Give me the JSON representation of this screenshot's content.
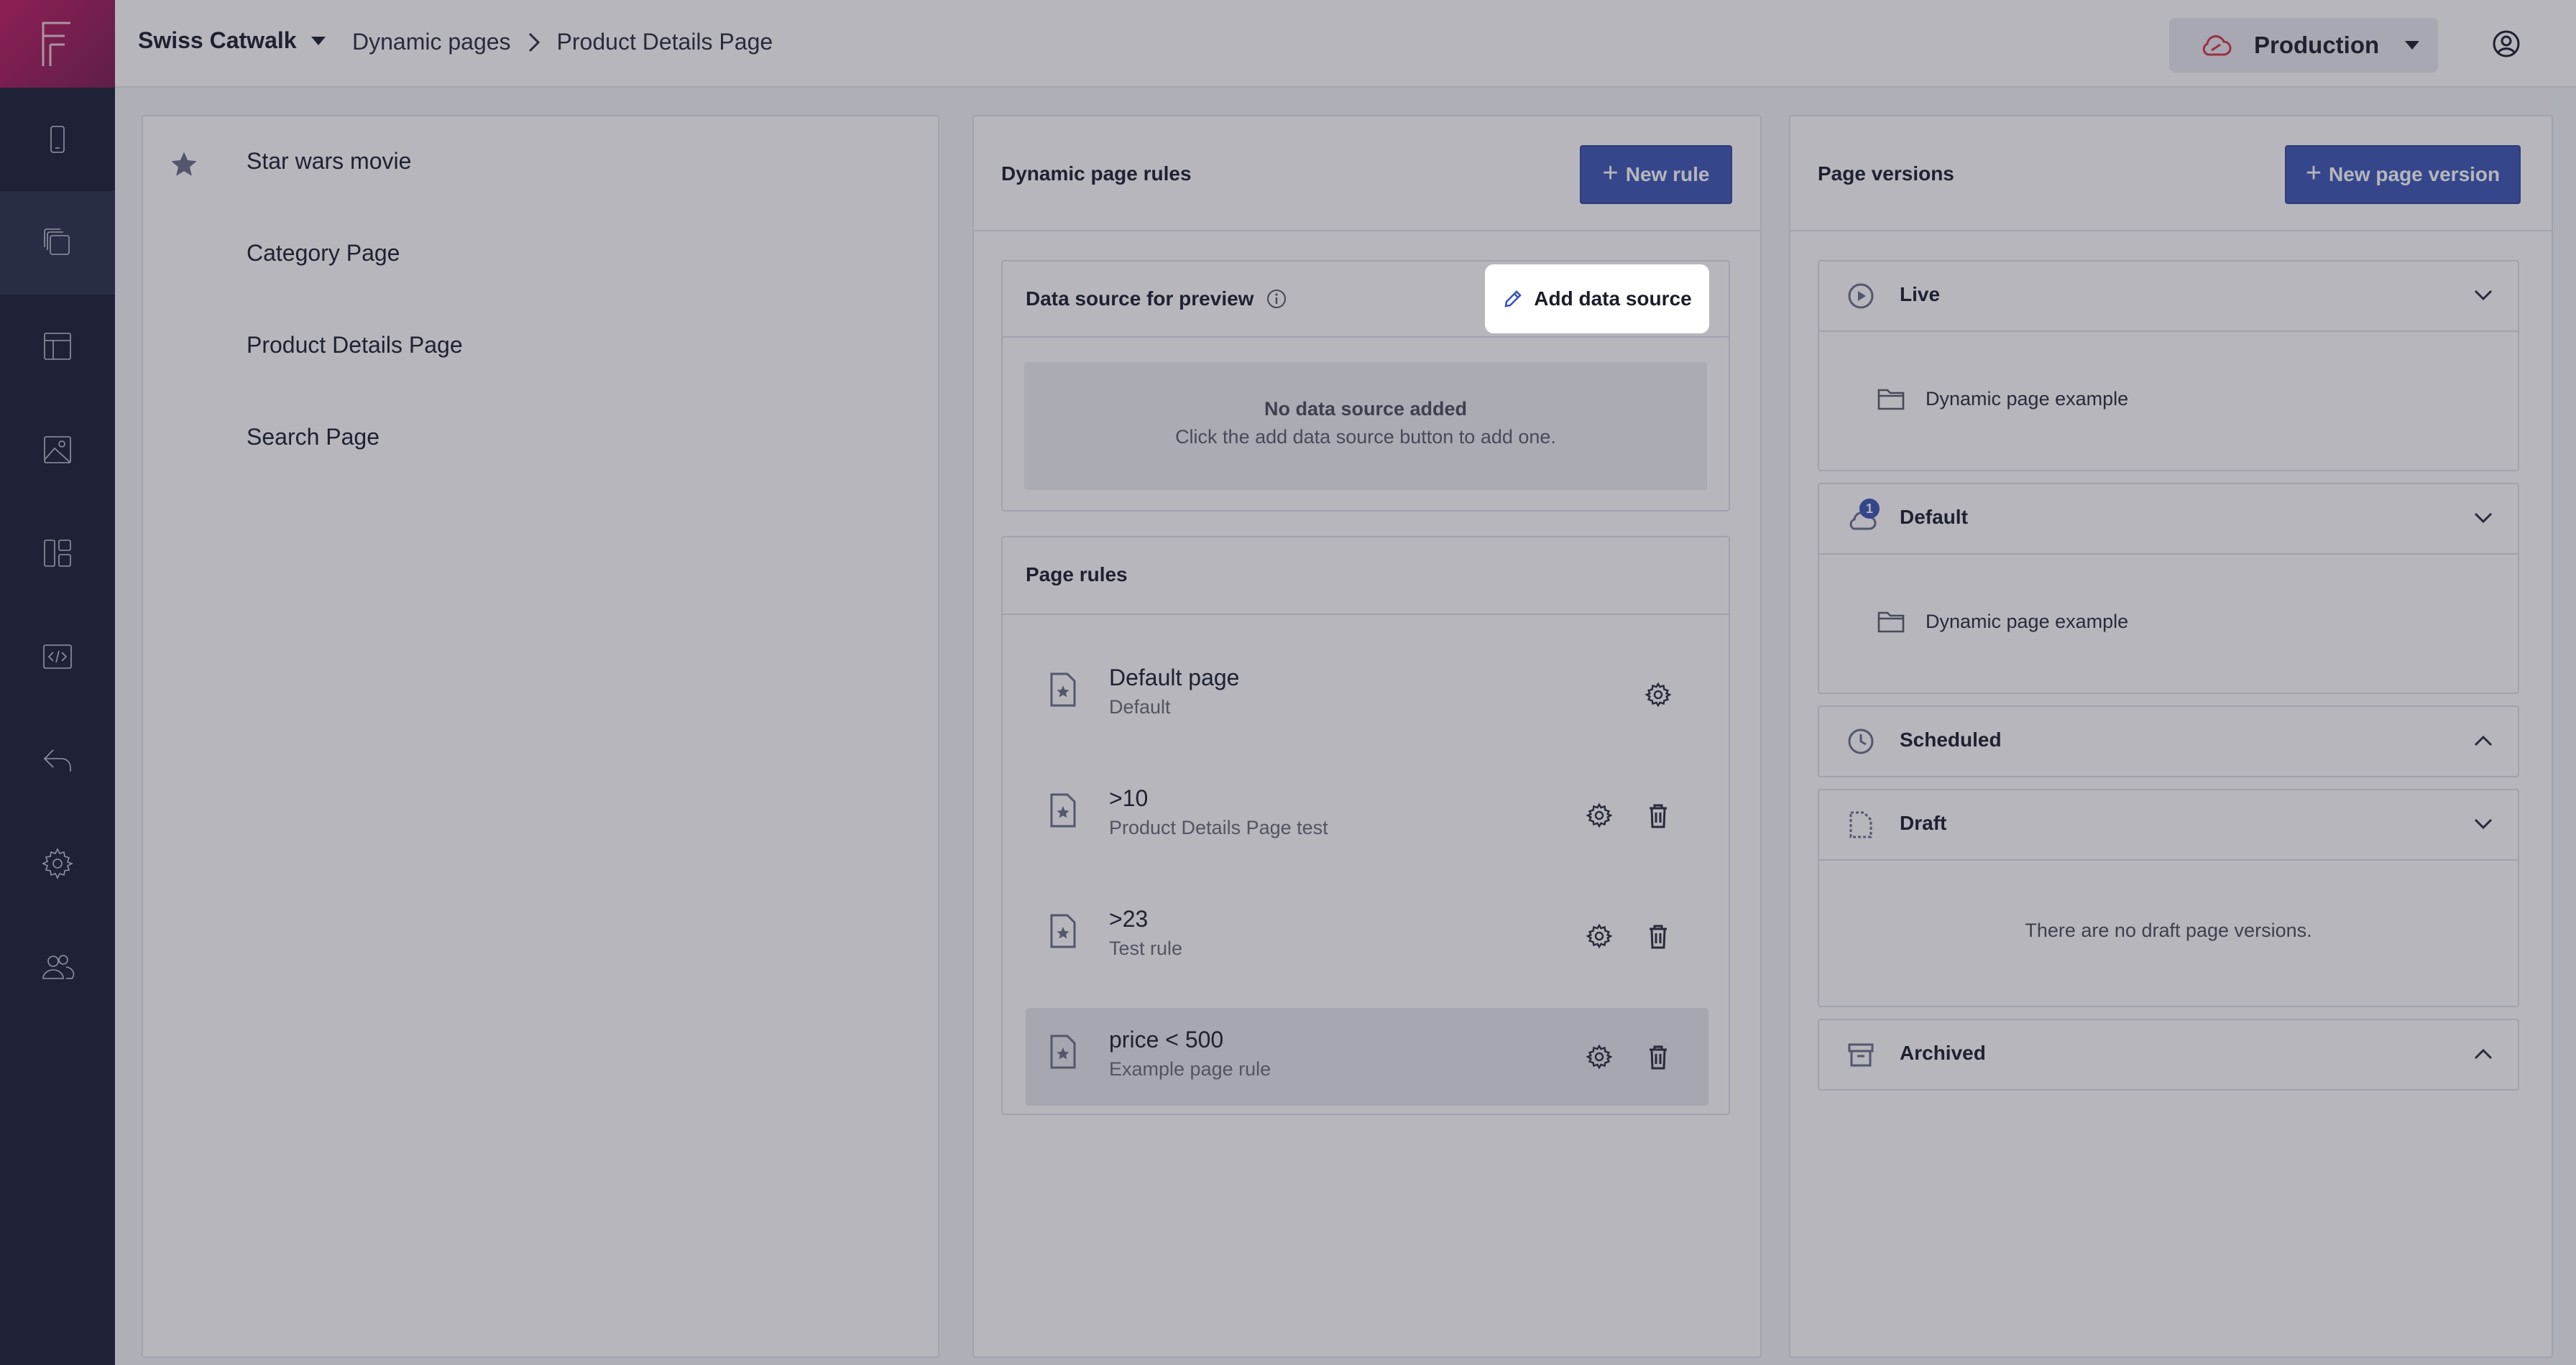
{
  "app": {
    "org_name": "Swiss Catwalk",
    "environment": "Production"
  },
  "breadcrumb": {
    "parent": "Dynamic pages",
    "current": "Product Details Page"
  },
  "sidebar": {
    "items": [
      {
        "icon": "mobile-icon"
      },
      {
        "icon": "pages-icon",
        "active": true
      },
      {
        "icon": "layout-icon"
      },
      {
        "icon": "image-icon"
      },
      {
        "icon": "components-icon"
      },
      {
        "icon": "code-icon"
      },
      {
        "icon": "undo-icon"
      },
      {
        "icon": "settings-icon"
      },
      {
        "icon": "users-icon"
      }
    ]
  },
  "pages_list": [
    {
      "label": "Star wars movie",
      "starred": true
    },
    {
      "label": "Category Page"
    },
    {
      "label": "Product Details Page"
    },
    {
      "label": "Search Page"
    }
  ],
  "rules_panel": {
    "title": "Dynamic page rules",
    "new_rule_label": "New rule",
    "data_source": {
      "title": "Data source for preview",
      "add_label": "Add data source",
      "empty_title": "No data source added",
      "empty_text": "Click the add data source button to add one."
    },
    "page_rules_title": "Page rules",
    "rules": [
      {
        "name": "Default page",
        "subtitle": "Default"
      },
      {
        "name": ">10",
        "subtitle": "Product Details Page test"
      },
      {
        "name": ">23",
        "subtitle": "Test rule"
      },
      {
        "name": "price < 500",
        "subtitle": "Example page rule",
        "selected": true
      }
    ]
  },
  "versions_panel": {
    "title": "Page versions",
    "new_version_label": "New page version",
    "sections": [
      {
        "title": "Live",
        "item": "Dynamic page example",
        "expanded": true
      },
      {
        "title": "Default",
        "item": "Dynamic page example",
        "badge": "1",
        "expanded": true
      },
      {
        "title": "Scheduled",
        "expanded": false
      },
      {
        "title": "Draft",
        "empty_text": "There are no draft page versions.",
        "expanded": true
      },
      {
        "title": "Archived",
        "expanded": false
      }
    ]
  },
  "colors": {
    "primary": "#3c56b5",
    "sidebar": "#1b1e36",
    "logo_start": "#c21b63",
    "env_icon": "#d9334a"
  }
}
